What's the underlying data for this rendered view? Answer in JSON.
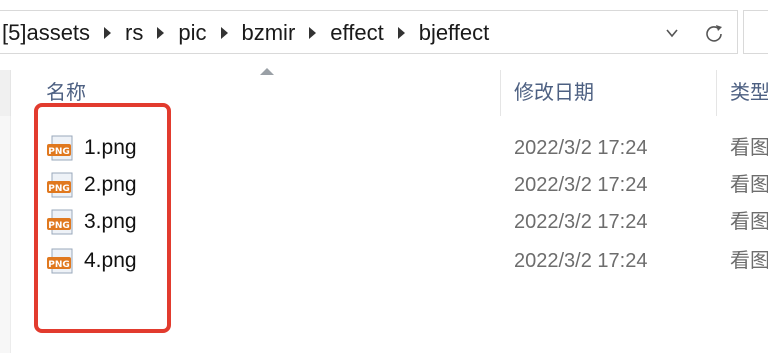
{
  "address": {
    "segments": [
      "[5]assets",
      "rs",
      "pic",
      "bzmir",
      "effect",
      "bjeffect"
    ]
  },
  "columns": {
    "name": "名称",
    "date": "修改日期",
    "type": "类型"
  },
  "files": [
    {
      "name": "1.png",
      "date": "2022/3/2 17:24",
      "type": "看图"
    },
    {
      "name": "2.png",
      "date": "2022/3/2 17:24",
      "type": "看图"
    },
    {
      "name": "3.png",
      "date": "2022/3/2 17:24",
      "type": "看图"
    },
    {
      "name": "4.png",
      "date": "2022/3/2 17:24",
      "type": "看图"
    }
  ],
  "icons": {
    "file": "png-file-icon",
    "dropdown": "chevron-down-icon",
    "refresh": "refresh-icon",
    "separator": "chevron-right-icon"
  },
  "colors": {
    "highlight": "#e23b2e",
    "header_text": "#4d6082",
    "png_badge": "#e0781e"
  }
}
